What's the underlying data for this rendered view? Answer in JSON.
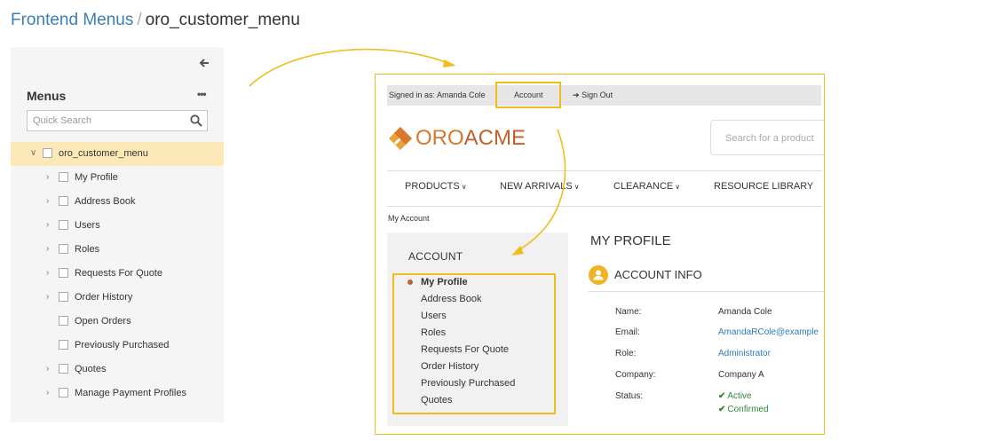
{
  "breadcrumb": {
    "parent": "Frontend Menus",
    "separator": "/",
    "current": "oro_customer_menu"
  },
  "panel": {
    "title": "Menus",
    "more": "•••",
    "search_placeholder": "Quick Search",
    "tree": [
      {
        "label": "oro_customer_menu",
        "expanded": true,
        "selected": true
      },
      {
        "label": "My Profile",
        "has_children": true
      },
      {
        "label": "Address Book",
        "has_children": true
      },
      {
        "label": "Users",
        "has_children": true
      },
      {
        "label": "Roles",
        "has_children": true
      },
      {
        "label": "Requests For Quote",
        "has_children": true
      },
      {
        "label": "Order History",
        "has_children": true
      },
      {
        "label": "Open Orders",
        "has_children": false
      },
      {
        "label": "Previously Purchased",
        "has_children": false
      },
      {
        "label": "Quotes",
        "has_children": true
      },
      {
        "label": "Manage Payment Profiles",
        "has_children": true
      }
    ]
  },
  "store": {
    "topbar": {
      "signed_in": "Signed in as: Amanda Cole",
      "account": "Account",
      "sign_out": "Sign Out"
    },
    "logo": {
      "part1": "ORO",
      "part2": "ACME"
    },
    "search_placeholder": "Search for a product",
    "nav": [
      {
        "label": "PRODUCTS",
        "caret": true
      },
      {
        "label": "NEW ARRIVALS",
        "caret": true
      },
      {
        "label": "CLEARANCE",
        "caret": true
      },
      {
        "label": "RESOURCE LIBRARY",
        "caret": false
      }
    ],
    "breadcrumb": "My Account",
    "sidebar": {
      "title": "ACCOUNT",
      "items": [
        "My Profile",
        "Address Book",
        "Users",
        "Roles",
        "Requests For Quote",
        "Order History",
        "Previously Purchased",
        "Quotes"
      ]
    },
    "profile_title": "MY PROFILE",
    "account_info_title": "ACCOUNT INFO",
    "info": [
      {
        "label": "Name:",
        "value": "Amanda Cole"
      },
      {
        "label": "Email:",
        "value": "AmandaRCole@example"
      },
      {
        "label": "Role:",
        "value": "Administrator"
      },
      {
        "label": "Company:",
        "value": "Company A"
      },
      {
        "label": "Status:",
        "values": [
          "Active",
          "Confirmed"
        ]
      }
    ]
  },
  "colors": {
    "accent": "#f0bd1e",
    "link": "#3a7fb4",
    "brand": "#d9772b",
    "selected_row": "#fde9b8"
  }
}
